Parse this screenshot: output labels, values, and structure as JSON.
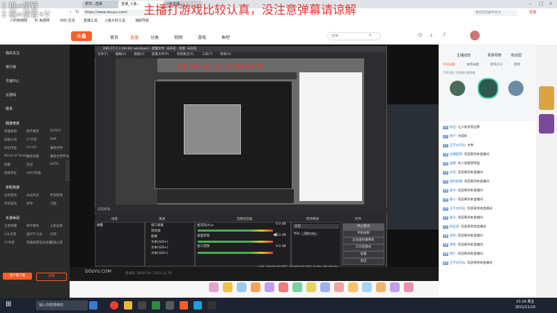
{
  "overlay": {
    "top_left_line1": "2 桃=房管",
    "top_left_line2": "2 福=房管+V",
    "banner": "主播打游戏比较认真，没注意弹幕请谅解",
    "banner_inner": "主播打游戏比较认真，没注意弹幕请谅解"
  },
  "browser": {
    "tabs": [
      "老司...直播",
      "直播_斗鱼...",
      "斗鱼直播"
    ],
    "url": "https://www.douyu.com/",
    "bookmarks": [
      "人的常用网",
      "Ki 免费网",
      "SNS 生活",
      "直播工具",
      "斗鱼大的工具",
      "海韵导航"
    ],
    "search_placeholder": "我的浏览器中访问",
    "top_right_label": "直播"
  },
  "douyu": {
    "logo": "斗鱼",
    "nav": [
      "首页",
      "直播",
      "分类",
      "视频",
      "游戏",
      "鱼吧"
    ],
    "search_placeholder": "搜索"
  },
  "sidebar": {
    "items": [
      "我的关注",
      "排行榜",
      "灵魂中心",
      "云游戏",
      "赛事"
    ],
    "sections": [
      {
        "title": "网游竞技",
        "games": [
          "英雄联盟",
          "和平精英",
          "DOTA2",
          "穿越火线",
          "CF手游",
          "DNF",
          "炉石传说",
          "CS:GO",
          "魔兽世界",
          "World of Tanks",
          "魔兽争霸",
          "魔兽世界怀旧",
          "街霸",
          "逆战",
          "DOTA",
          "绝地求生",
          "APEX英雄"
        ]
      },
      {
        "title": "单机热游",
        "games": [
          "主机游戏",
          "永劫无间",
          "怀旧游戏",
          "单机游戏",
          "原神",
          "只狼"
        ]
      },
      {
        "title": "手游休闲",
        "games": [
          "王者荣耀",
          "和平精英",
          "火影忍者",
          "LOL手游",
          "金铲铲之战",
          "幻塔",
          "CF手游",
          "英雄联盟电竞经理",
          "月圆之夜"
        ]
      }
    ],
    "bottom": [
      "客户端下载",
      "开播"
    ]
  },
  "obs": {
    "title": "OBS 27.1.3 (64-bit, windows) - 配置文件: 未命名 - 场景: 未命名",
    "menu": [
      "文件(F)",
      "编辑(E)",
      "视图(V)",
      "配置文件(P)",
      "场景集合(S)",
      "工具(T)",
      "帮助(H)"
    ],
    "source_label": "未选择源",
    "dock_titles": [
      "场景",
      "来源",
      "音频混音器",
      "转场特效",
      "控件"
    ],
    "scene": "场景",
    "sources": [
      "窗口采集",
      "游戏源",
      "图像",
      "文本(GDI+)",
      "文本(GDI+)",
      "文本(GDI+)"
    ],
    "mixer": [
      {
        "name": "麦克风/Aux",
        "db": "0.0 dB"
      },
      {
        "name": "桌面音频",
        "db": "0.0 dB"
      },
      {
        "name": "窗口音频",
        "db": "0.0 dB"
      }
    ],
    "transition": "淡出",
    "duration_label": "时长",
    "duration": "300 ms",
    "controls": [
      "停止推流",
      "开始录制",
      "启动虚拟摄像机",
      "工作室模式",
      "设置",
      "退出"
    ],
    "status": "LIVE: 00:00:00   REC: 00:00:00   CPU: 6.0%, 60.00 fps"
  },
  "player": {
    "watermark": "DOUYU.COM",
    "room_info": "房间号: 5420718 | 2021.11.19"
  },
  "rank": {
    "tabs": [
      "主播动态",
      "贵族周榜",
      "粉丝团"
    ],
    "subtabs": [
      "今日贡献",
      "本周贡献",
      "贵宾(21)",
      "贵宾"
    ],
    "note": "TOP3用户可获得专属荣耀"
  },
  "chat": [
    {
      "lv": "21",
      "name": "粉丝",
      "text": "让人很享受这种"
    },
    {
      "lv": "17",
      "name": "用户",
      "text": "点得好"
    },
    {
      "lv": "17",
      "name": "王不太的兵",
      "text": "太秀"
    },
    {
      "lv": "18",
      "name": "主播超管",
      "text": "欢迎来到本直播间"
    },
    {
      "lv": "20",
      "name": "迷雾",
      "text": "有人就要回帝国"
    },
    {
      "lv": "21",
      "name": "水友",
      "text": "欢迎来到本直播间"
    },
    {
      "lv": "16",
      "name": "福利直播",
      "text": "欢迎来到本直播间"
    },
    {
      "lv": "14",
      "name": "观众",
      "text": "欢迎来到本直播间"
    },
    {
      "lv": "16",
      "name": "路人",
      "text": "欢迎来到本直播间"
    },
    {
      "lv": "20",
      "name": "王不太的兵",
      "text": "欢迎来到本直播间"
    },
    {
      "lv": "17",
      "name": "观众",
      "text": "欢迎来到本直播间"
    },
    {
      "lv": "17",
      "name": "粉丝团",
      "text": "欢迎来到本直播间"
    },
    {
      "lv": "19",
      "name": "老粉",
      "text": "欢迎来到本直播间"
    },
    {
      "lv": "12",
      "name": "游客",
      "text": "欢迎来到本直播间"
    },
    {
      "lv": "16",
      "name": "用户",
      "text": "欢迎来到本直播间"
    },
    {
      "lv": "21",
      "name": "王不太的兵",
      "text": "欢迎来到本直播间"
    }
  ],
  "taskbar": {
    "search": "输入你想搜索的",
    "time": "21:14 周五",
    "date": "2021/11/19"
  },
  "colors": {
    "accent": "#ff5d23",
    "banner": "#e53935"
  }
}
